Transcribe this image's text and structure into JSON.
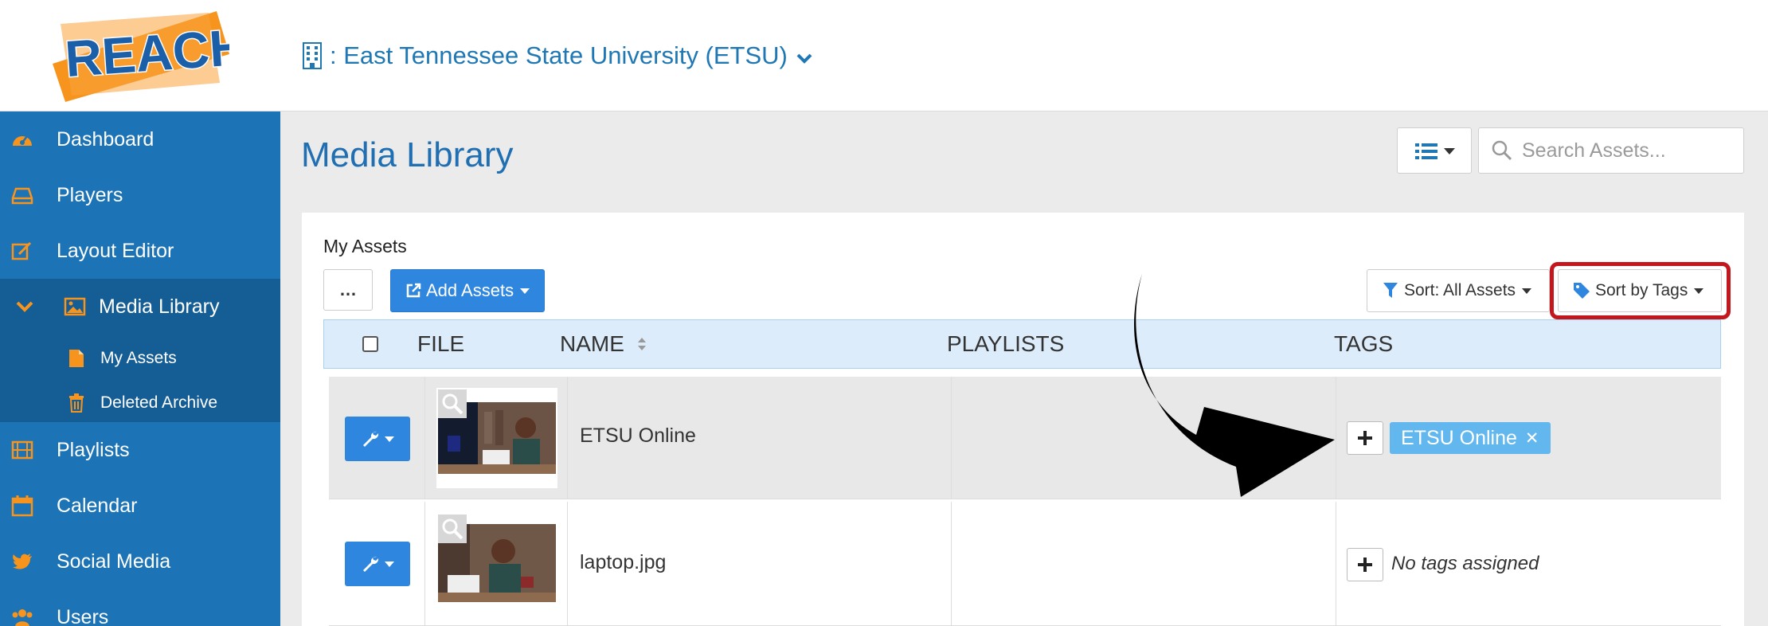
{
  "app": {
    "logo_text": "REACH",
    "org_name": ": East Tennessee State University (ETSU)"
  },
  "sidebar": {
    "items": [
      {
        "label": "Dashboard",
        "icon": "dashboard-icon"
      },
      {
        "label": "Players",
        "icon": "player-icon"
      },
      {
        "label": "Layout Editor",
        "icon": "edit-icon"
      },
      {
        "label": "Media Library",
        "icon": "image-icon"
      },
      {
        "label": "Playlists",
        "icon": "film-icon"
      },
      {
        "label": "Calendar",
        "icon": "calendar-icon"
      },
      {
        "label": "Social Media",
        "icon": "twitter-icon"
      },
      {
        "label": "Users",
        "icon": "users-icon"
      }
    ],
    "sub_items": [
      {
        "label": "My Assets",
        "icon": "file-icon"
      },
      {
        "label": "Deleted Archive",
        "icon": "trash-icon"
      }
    ]
  },
  "main": {
    "title": "Media Library",
    "search_placeholder": "Search Assets...",
    "panel_title": "My Assets",
    "more_label": "…",
    "add_assets_label": "Add Assets",
    "sort_all_label": "Sort: All Assets",
    "sort_tags_label": "Sort by Tags",
    "columns": [
      "FILE",
      "NAME",
      "PLAYLISTS",
      "TAGS"
    ],
    "rows": [
      {
        "name": "ETSU Online",
        "tags": [
          "ETSU Online"
        ],
        "playlists": ""
      },
      {
        "name": "laptop.jpg",
        "tags": [],
        "no_tags_text": "No tags assigned",
        "playlists": ""
      }
    ]
  },
  "colors": {
    "accent": "#1c73b6",
    "button_blue": "#2f86df",
    "tag_blue": "#62b7ee",
    "highlight_red": "#c2171c",
    "logo_orange": "#f7941d"
  }
}
